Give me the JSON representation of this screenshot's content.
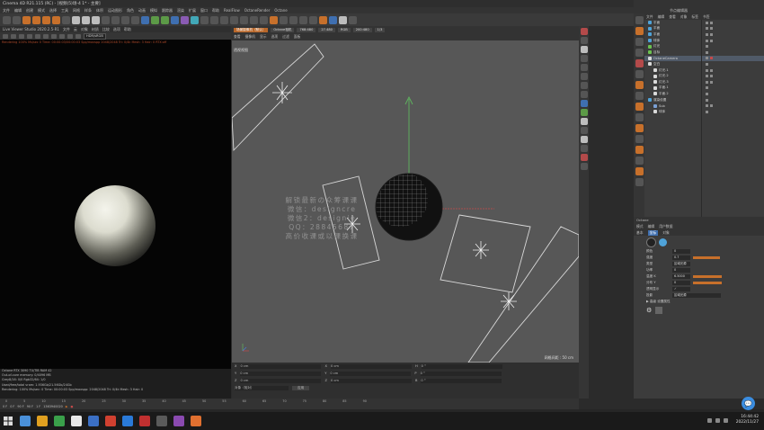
{
  "window": {
    "title": "Cinema 4D R21.115 (RC) - [视频(5)场-4 1* - 主要]",
    "controls": [
      "—",
      "☐",
      "✕"
    ],
    "top_right_text": "节点编辑器"
  },
  "menubar": [
    "文件",
    "编辑",
    "创建",
    "模式",
    "选择",
    "工具",
    "网格",
    "样条",
    "体积",
    "运动图形",
    "角色",
    "动画",
    "模拟",
    "跟踪器",
    "渲染",
    "扩展",
    "窗口",
    "帮助",
    "RealFlow",
    "OctaneRender",
    "Octane"
  ],
  "live_viewer": {
    "tab_label": "Live Viewer Studio 2020.2.5-R1",
    "menu": [
      "文件",
      "云",
      "对象",
      "材质",
      "比较",
      "选项",
      "帮助"
    ],
    "mode_label": "HDR/sRGB",
    "render_info": "Rendering 100%  Ms/sec 0  Time: 00:00:03/00:00:03  Spp/maxspp 2048/2048  Tri: 0/4k  Mesh: 3  Hair: 0  RTX:off",
    "stats": [
      "Octane RTX 3090 TU/TIB RAM 42",
      "Out-of-core memory: 0/4096 MB",
      "Grey8/16: 0/0      Rgb32/64: 1/0",
      "Used/free/total vram: 1.936Gb/21.56Gb/24Gb",
      "Rendering: 100%  Ms/sec: 0  Time: 00:00:03  Spp/maxspp: 2048/2048  Tri: 0/4k  Mesh: 3  Hair: 0"
    ]
  },
  "viewport": {
    "name": "透视视图",
    "menu": [
      "查看",
      "摄像机",
      "显示",
      "选项",
      "过滤",
      "面板"
    ],
    "cameras": [
      "场景摄像机（默认）",
      "Octane相机",
      "768:480",
      "27.480",
      "RGB",
      "200:480",
      "1/3"
    ],
    "grid_label": "网格间距 : 50 cm",
    "watermark_lines": [
      "解锁最新の众筹课课",
      "微信：designcre",
      "微信2：designie",
      "QQ：28845681",
      "高价收课或以课换课"
    ]
  },
  "object_manager": {
    "menu": [
      "文件",
      "编辑",
      "查看",
      "对象",
      "标签",
      "书签"
    ],
    "objects": [
      {
        "name": "平面",
        "color": "#4fa3d9"
      },
      {
        "name": "平面",
        "color": "#4fa3d9"
      },
      {
        "name": "平面",
        "color": "#4fa3d9"
      },
      {
        "name": "球体",
        "color": "#4fa3d9"
      },
      {
        "name": "灯光",
        "color": "#6bc24f"
      },
      {
        "name": "目标",
        "color": "#6bc24f"
      },
      {
        "name": "OctaneCamera",
        "color": "#d9d9d9"
      },
      {
        "name": "空白",
        "color": "#d9d9d9"
      },
      {
        "name": "灯光.1",
        "color": "#d9d9d9"
      },
      {
        "name": "灯光.2",
        "color": "#d9d9d9"
      },
      {
        "name": "灯光.3",
        "color": "#d9d9d9"
      },
      {
        "name": "平面.1",
        "color": "#d9d9d9"
      },
      {
        "name": "平面.2",
        "color": "#d9d9d9"
      },
      {
        "name": "渲染设置",
        "color": "#4fa3d9"
      },
      {
        "name": "Sub",
        "color": "#7aa0d4"
      },
      {
        "name": "球体",
        "color": "#d9d9d9"
      }
    ]
  },
  "attributes": {
    "menu": [
      "模式",
      "编辑",
      "用户数据"
    ],
    "object_label": "Octane",
    "tabs": [
      "基本",
      "坐标",
      "对象"
    ],
    "rows": [
      {
        "k": "颜色",
        "v": "0"
      },
      {
        "k": "强度",
        "v": "0.7"
      },
      {
        "k": "类型",
        "v": "区域光源"
      },
      {
        "k": "功率",
        "v": "0"
      },
      {
        "k": "温度 K",
        "v": "6.5000"
      },
      {
        "k": "分布 Y",
        "v": "0"
      },
      {
        "k": "透明显示",
        "v": "✓"
      },
      {
        "k": "投影",
        "v": "区域光源"
      }
    ],
    "extra": "▶ 高级 设置属性"
  },
  "timeline": {
    "ticks": [
      "0",
      "5",
      "10",
      "15",
      "20",
      "25",
      "30",
      "35",
      "40",
      "45",
      "50",
      "55",
      "60",
      "65",
      "70",
      "75",
      "80",
      "85",
      "90"
    ],
    "controls": [
      "0 F",
      "0 F",
      "90 F",
      "90 F"
    ],
    "current_frame": "1  F"
  },
  "coordinates": {
    "rows": [
      {
        "a": "X",
        "b": "0 cm",
        "c": "X",
        "d": "0 cm",
        "e": "H",
        "f": "0 °"
      },
      {
        "a": "Y",
        "b": "0 cm",
        "c": "Y",
        "d": "0 cm",
        "e": "P",
        "f": "0 °"
      },
      {
        "a": "Z",
        "b": "0 cm",
        "c": "Z",
        "d": "0 cm",
        "e": "B",
        "f": "0 °"
      }
    ],
    "mode": "对象（相对）",
    "apply": "应用",
    "phone": "1363940020"
  },
  "taskbar": {
    "time": "16:44:42",
    "date": "2022/11/27",
    "apps": [
      "#4a90d9",
      "#e0a020",
      "#3aa04a",
      "#e8e8e8",
      "#3b6fc4",
      "#d04030",
      "#2a7ad8",
      "#c03030",
      "#5a5a5a",
      "#8a4ab0",
      "#e07030"
    ]
  },
  "colors": {
    "accent": "#c7702b",
    "viewport_bg": "#575757",
    "selection": "#505a68"
  }
}
